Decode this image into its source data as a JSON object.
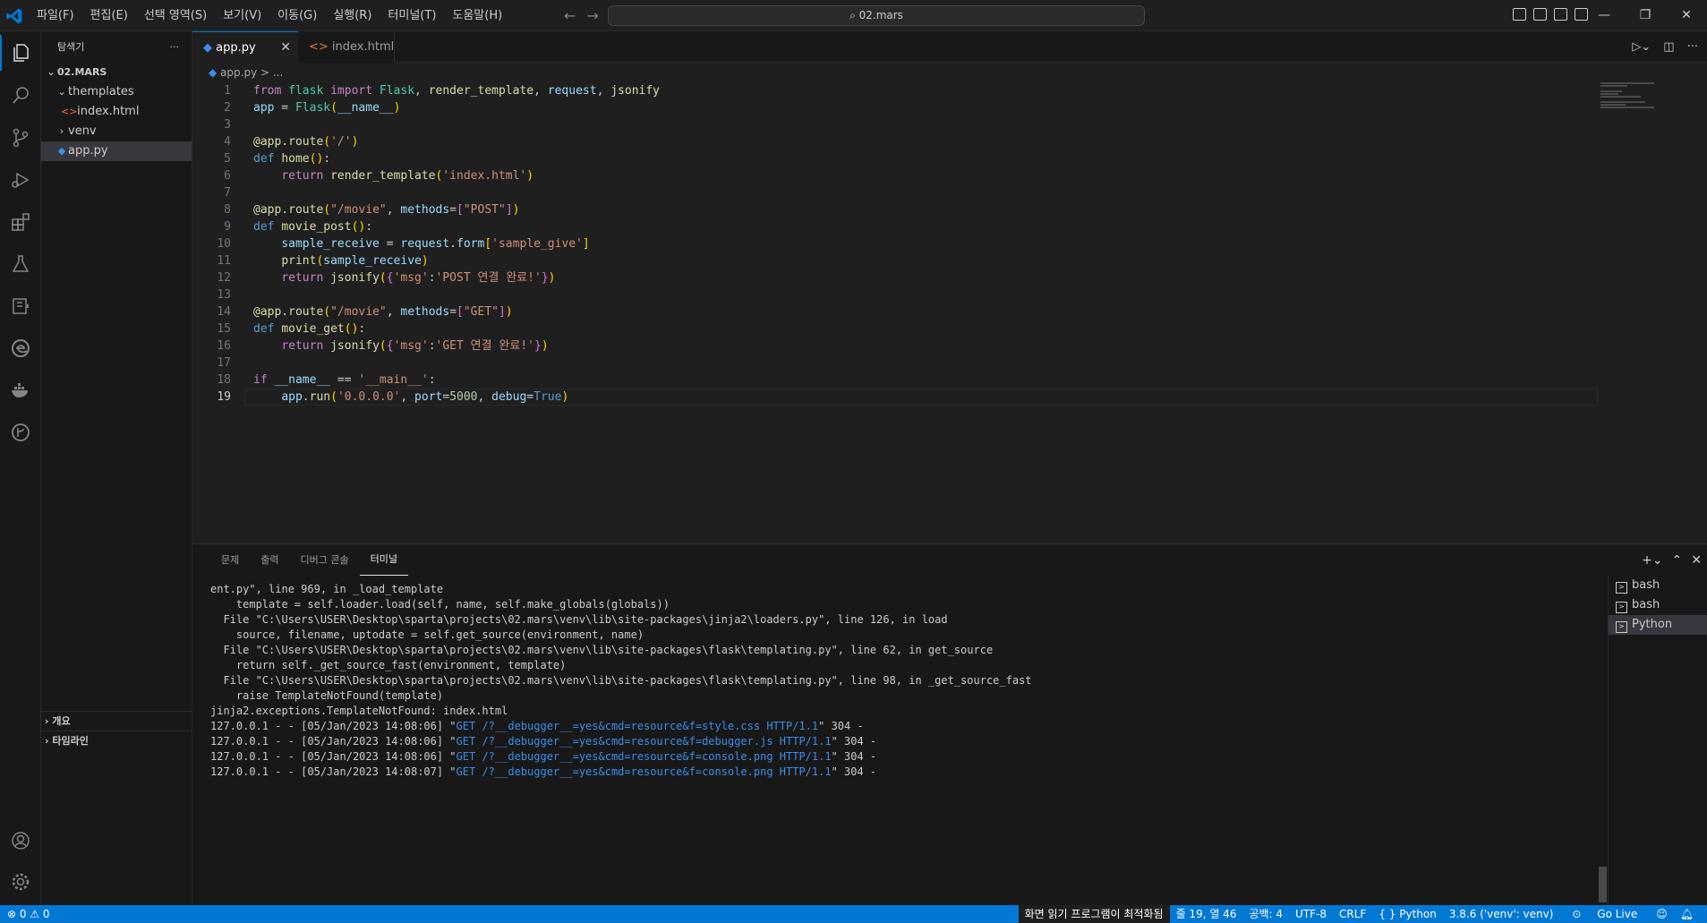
{
  "menu": [
    "파일(F)",
    "편집(E)",
    "선택 영역(S)",
    "보기(V)",
    "이동(G)",
    "실행(R)",
    "터미널(T)",
    "도움말(H)"
  ],
  "search": {
    "text": "02.mars"
  },
  "window_controls": [
    "—",
    "❐",
    "✕"
  ],
  "sidebar": {
    "title": "탐색기",
    "more": "···",
    "root": "02.MARS",
    "tree": {
      "templates": "themplates",
      "index_html": "index.html",
      "venv": "venv",
      "app_py": "app.py"
    },
    "outline": "개요",
    "timeline": "타임라인"
  },
  "tabs": [
    {
      "label": "app.py",
      "active": true
    },
    {
      "label": "index.html",
      "active": false
    }
  ],
  "breadcrumb": "app.py > ...",
  "code_lines": [
    "from flask import Flask, render_template, request, jsonify",
    "app = Flask(__name__)",
    "",
    "@app.route('/')",
    "def home():",
    "    return render_template('index.html')",
    "",
    "@app.route(\"/movie\", methods=[\"POST\"])",
    "def movie_post():",
    "    sample_receive = request.form['sample_give']",
    "    print(sample_receive)",
    "    return jsonify({'msg':'POST 연결 완료!'})",
    "",
    "@app.route(\"/movie\", methods=[\"GET\"])",
    "def movie_get():",
    "    return jsonify({'msg':'GET 연결 완료!'})",
    "",
    "if __name__ == '__main__':",
    "    app.run('0.0.0.0', port=5000, debug=True)"
  ],
  "current_line": 19,
  "panel": {
    "tabs": [
      "문제",
      "출력",
      "디버그 콘솔",
      "터미널"
    ],
    "active_tab": "터미널",
    "terminal_lines": [
      "ent.py\", line 969, in _load_template",
      "    template = self.loader.load(self, name, self.make_globals(globals))",
      "  File \"C:\\Users\\USER\\Desktop\\sparta\\projects\\02.mars\\venv\\lib\\site-packages\\jinja2\\loaders.py\", line 126, in load",
      "    source, filename, uptodate = self.get_source(environment, name)",
      "  File \"C:\\Users\\USER\\Desktop\\sparta\\projects\\02.mars\\venv\\lib\\site-packages\\flask\\templating.py\", line 62, in get_source",
      "    return self._get_source_fast(environment, template)",
      "  File \"C:\\Users\\USER\\Desktop\\sparta\\projects\\02.mars\\venv\\lib\\site-packages\\flask\\templating.py\", line 98, in _get_source_fast",
      "    raise TemplateNotFound(template)",
      "jinja2.exceptions.TemplateNotFound: index.html"
    ],
    "request_lines": [
      {
        "prefix": "127.0.0.1 - - [05/Jan/2023 14:08:06] \"",
        "link": "GET /?__debugger__=yes&cmd=resource&f=style.css HTTP/1.1",
        "suffix": "\" 304 -"
      },
      {
        "prefix": "127.0.0.1 - - [05/Jan/2023 14:08:06] \"",
        "link": "GET /?__debugger__=yes&cmd=resource&f=debugger.js HTTP/1.1",
        "suffix": "\" 304 -"
      },
      {
        "prefix": "127.0.0.1 - - [05/Jan/2023 14:08:06] \"",
        "link": "GET /?__debugger__=yes&cmd=resource&f=console.png HTTP/1.1",
        "suffix": "\" 304 -"
      },
      {
        "prefix": "127.0.0.1 - - [05/Jan/2023 14:08:07] \"",
        "link": "GET /?__debugger__=yes&cmd=resource&f=console.png HTTP/1.1",
        "suffix": "\" 304 -"
      }
    ],
    "terminals": [
      "bash",
      "bash",
      "Python"
    ],
    "active_terminal": "Python"
  },
  "statusbar": {
    "problems": "⊗ 0 ⚠ 0",
    "screen_reader": "화면 읽기 프로그램이 최적화됨",
    "position": "줄 19, 열 46",
    "spaces": "공백: 4",
    "encoding": "UTF-8",
    "eol": "CRLF",
    "language": "{ } Python",
    "interpreter": "3.8.6 ('venv': venv)",
    "golive": "Go Live"
  },
  "colors": {
    "accent": "#0078d4",
    "statusbar": "#0078d4",
    "background": "#1f1f1f"
  }
}
